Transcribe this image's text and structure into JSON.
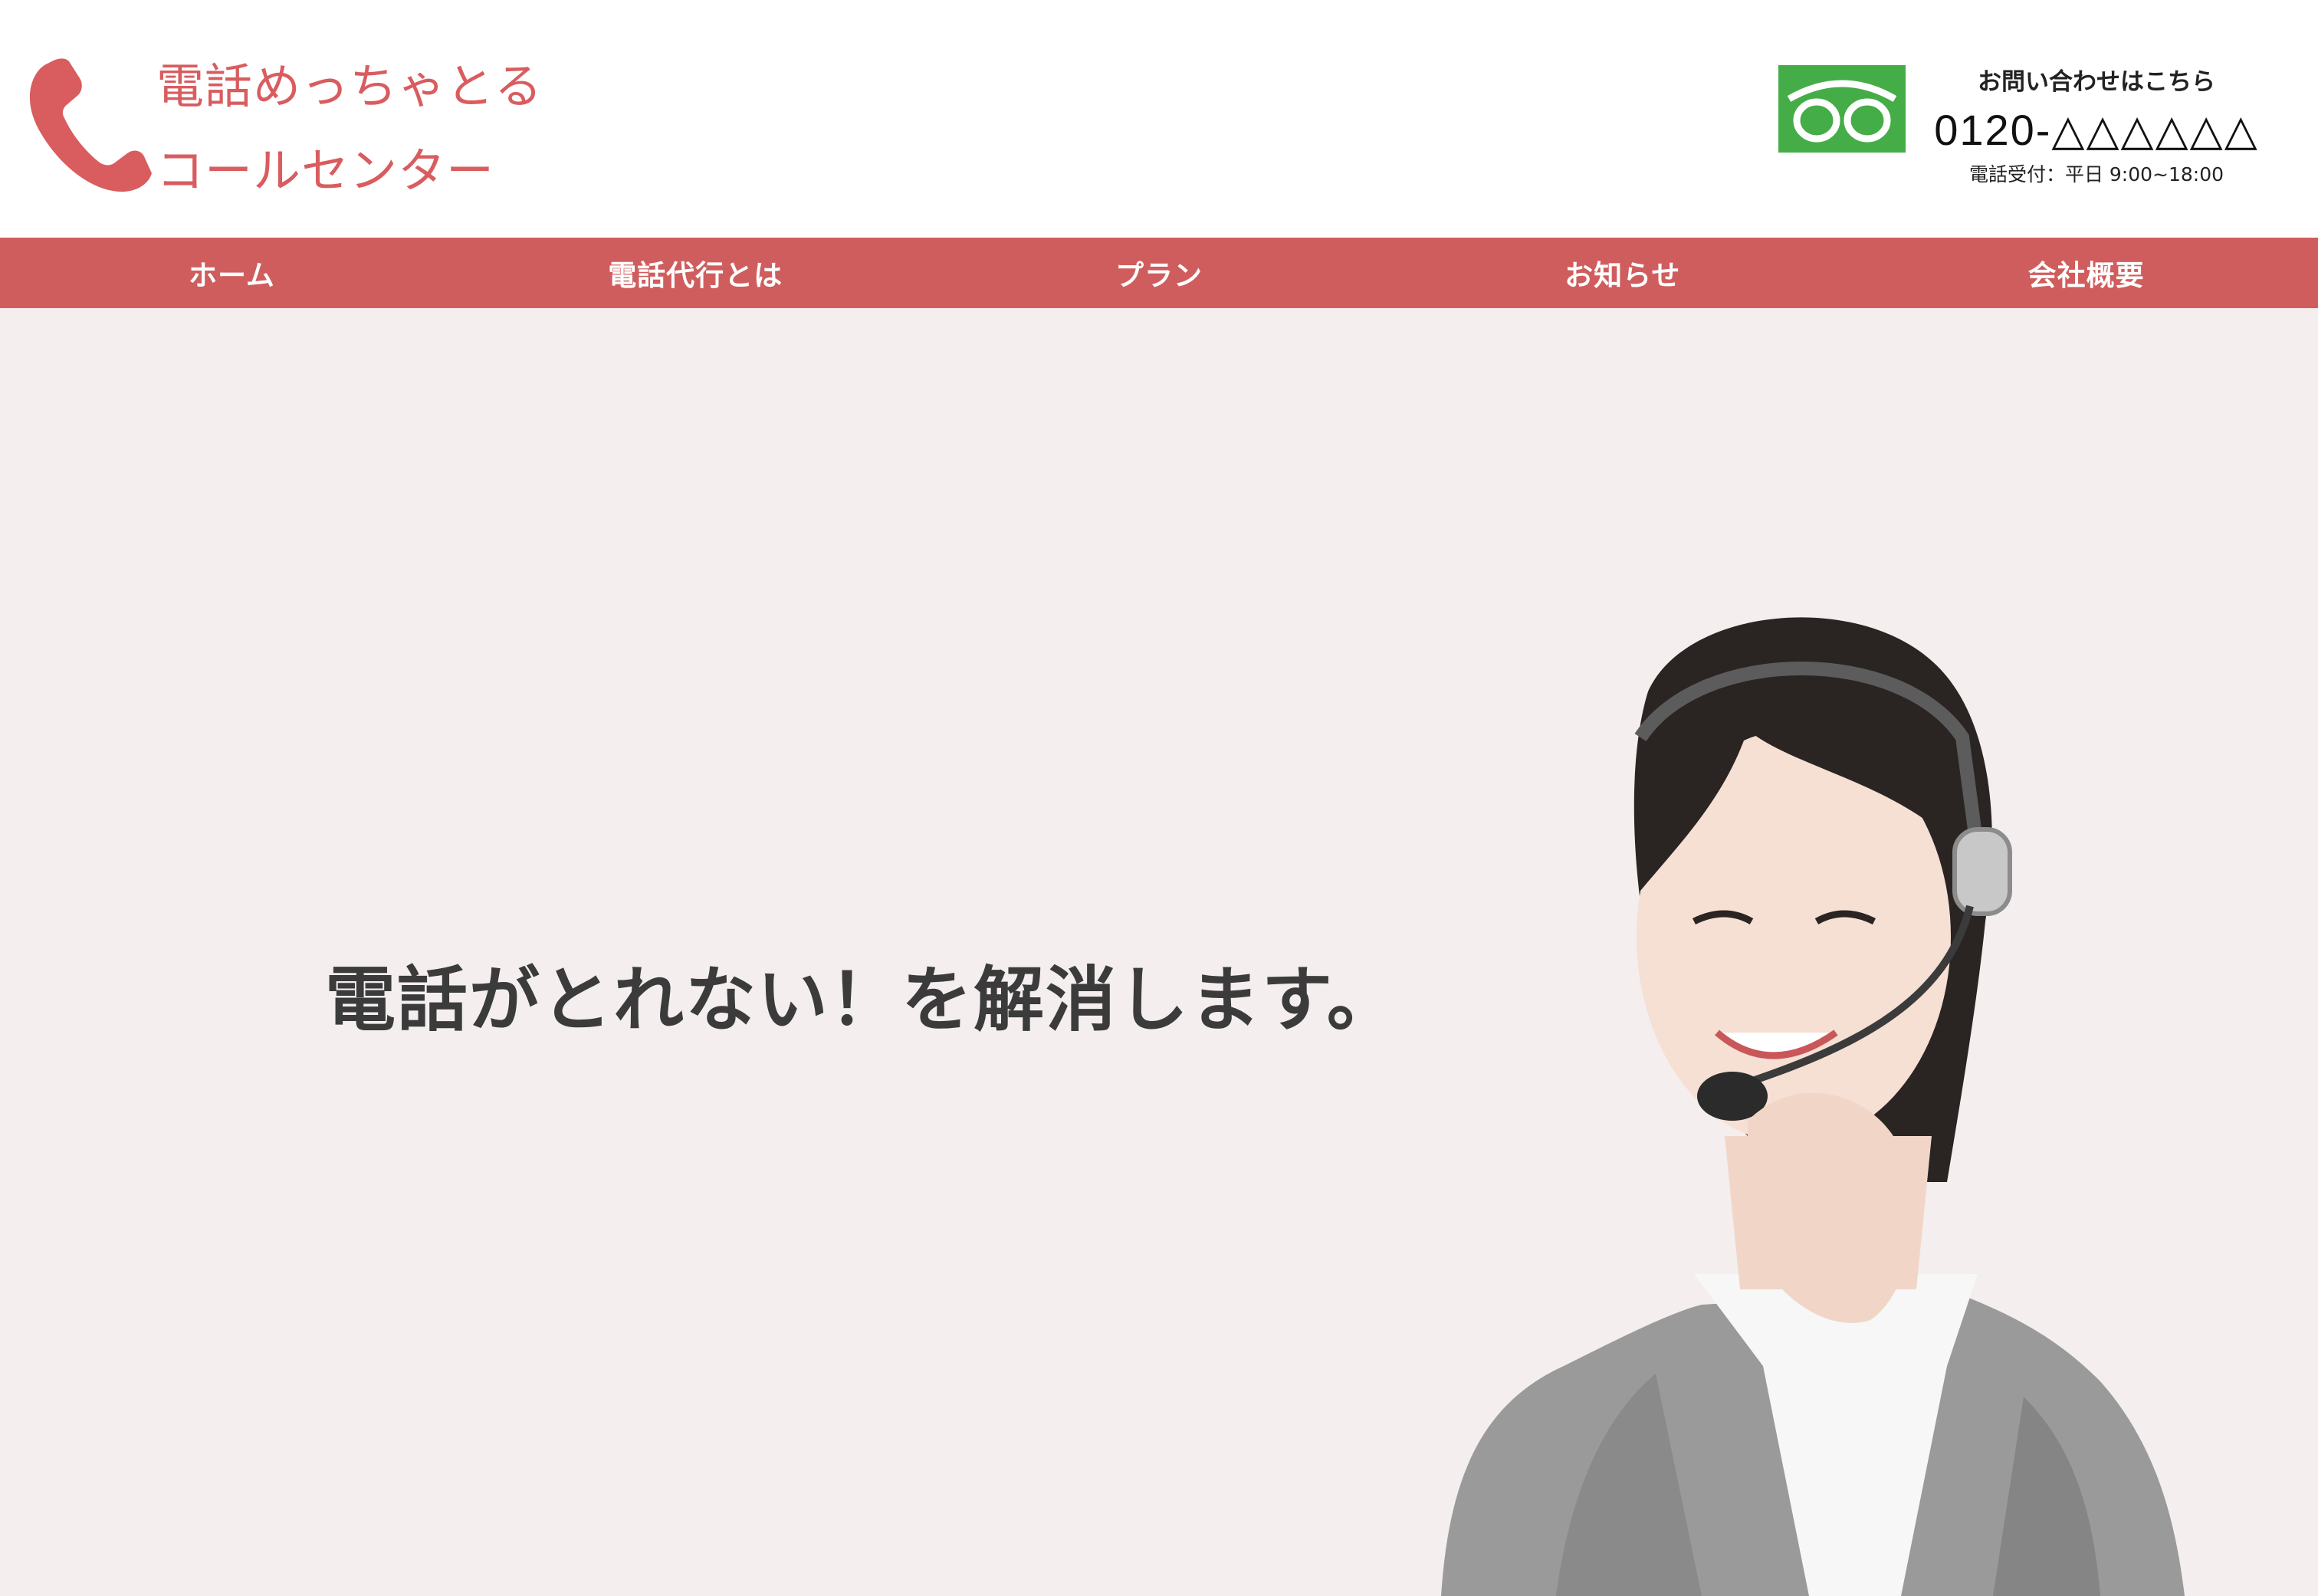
{
  "header": {
    "brand_line1": "電話めっちゃとる",
    "brand_line2": "コールセンター",
    "contact_label": "お問い合わせはこちら",
    "contact_phone": "0120-△△△△△△",
    "contact_hours": "電話受付：平日 9:00~18:00",
    "logo_icon": "phone-handset-icon",
    "freedial_icon": "freedial-icon"
  },
  "nav": {
    "items": [
      {
        "label": "ホーム"
      },
      {
        "label": "電話代行とは"
      },
      {
        "label": "プラン"
      },
      {
        "label": "お知らせ"
      },
      {
        "label": "会社概要"
      }
    ]
  },
  "hero": {
    "title": "電話がとれない！を解消します。"
  },
  "colors": {
    "brand": "#d95c5f",
    "nav_background": "#d05d5d",
    "hero_background": "#f4eeee",
    "freedial_green": "#45ad48"
  }
}
